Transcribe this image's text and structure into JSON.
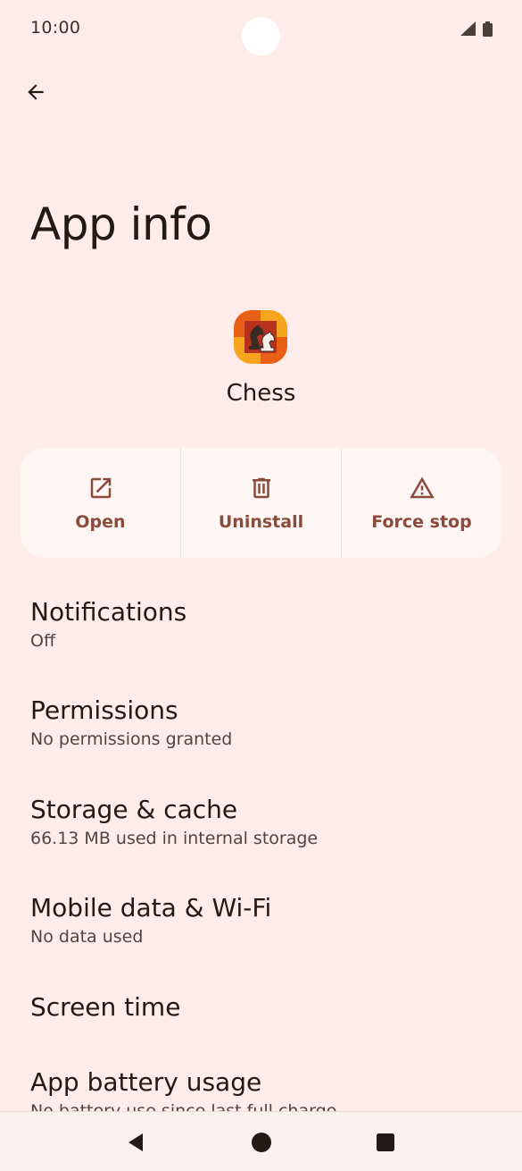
{
  "status_bar": {
    "time": "10:00",
    "icons": [
      "signal-icon",
      "battery-icon"
    ]
  },
  "header": {
    "back_icon": "arrow-back-icon",
    "title": "App info"
  },
  "app": {
    "name": "Chess",
    "icon": "chess-app-icon"
  },
  "actions": [
    {
      "label": "Open",
      "icon": "open-external-icon"
    },
    {
      "label": "Uninstall",
      "icon": "trash-icon"
    },
    {
      "label": "Force stop",
      "icon": "warning-icon"
    }
  ],
  "settings": [
    {
      "title": "Notifications",
      "subtitle": "Off"
    },
    {
      "title": "Permissions",
      "subtitle": "No permissions granted"
    },
    {
      "title": "Storage & cache",
      "subtitle": "66.13 MB used in internal storage"
    },
    {
      "title": "Mobile data & Wi-Fi",
      "subtitle": "No data used"
    },
    {
      "title": "Screen time"
    },
    {
      "title": "App battery usage",
      "subtitle": "No battery use since last full charge"
    }
  ],
  "nav_bar": {
    "icons": [
      "back-triangle-icon",
      "home-circle-icon",
      "recents-square-icon"
    ]
  },
  "colors": {
    "background": "#fdecea",
    "accent": "#8b4a3a",
    "card": "#fdf6f4",
    "text": "#231917"
  }
}
